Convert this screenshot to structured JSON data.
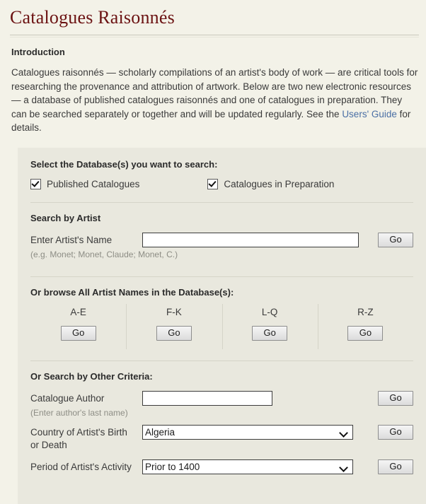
{
  "header": {
    "title": "Catalogues Raisonnés"
  },
  "intro": {
    "heading": "Introduction",
    "paragraph_part1": "Catalogues raisonnés — scholarly compilations of an artist's body of work — are critical tools for researching the provenance and attribution of artwork. Below are two new electronic resources — a database of published catalogues raisonnés and one of catalogues in preparation. They can be searched separately or together and will be updated regularly. See the ",
    "link_text": "Users' Guide",
    "paragraph_part2": " for details."
  },
  "panel": {
    "database_section": {
      "title": "Select the Database(s) you want to search:",
      "checkboxes": [
        {
          "label": "Published Catalogues",
          "checked": true
        },
        {
          "label": "Catalogues in Preparation",
          "checked": true
        }
      ]
    },
    "artist_section": {
      "title": "Search by Artist",
      "field_label": "Enter Artist's Name",
      "input_value": "",
      "input_placeholder": "",
      "hint": "(e.g. Monet; Monet, Claude; Monet, C.)",
      "go_label": "Go"
    },
    "browse_section": {
      "title": "Or browse All Artist Names in the Database(s):",
      "columns": [
        {
          "letters": "A-E",
          "go_label": "Go"
        },
        {
          "letters": "F-K",
          "go_label": "Go"
        },
        {
          "letters": "L-Q",
          "go_label": "Go"
        },
        {
          "letters": "R-Z",
          "go_label": "Go"
        }
      ]
    },
    "other_section": {
      "title": "Or Search by Other Criteria:",
      "author_label": "Catalogue Author",
      "author_value": "",
      "author_placeholder": "",
      "author_hint": "(Enter author's last name)",
      "author_go_label": "Go",
      "country_label_line1": "Country of Artist's Birth",
      "country_label_line2": "or Death",
      "country_value": "Algeria",
      "country_go_label": "Go",
      "period_label": "Period of Artist's Activity",
      "period_value": "Prior to 1400",
      "period_go_label": "Go"
    }
  },
  "colors": {
    "page_background": "#f3f2e8",
    "panel_background": "#e9e8de",
    "title": "#6b1212",
    "link": "#4a6fa5",
    "text": "#3a3a3a",
    "hint": "#8d8d85",
    "input_border": "#3c3c3c",
    "divider": "#d5d4c8"
  }
}
